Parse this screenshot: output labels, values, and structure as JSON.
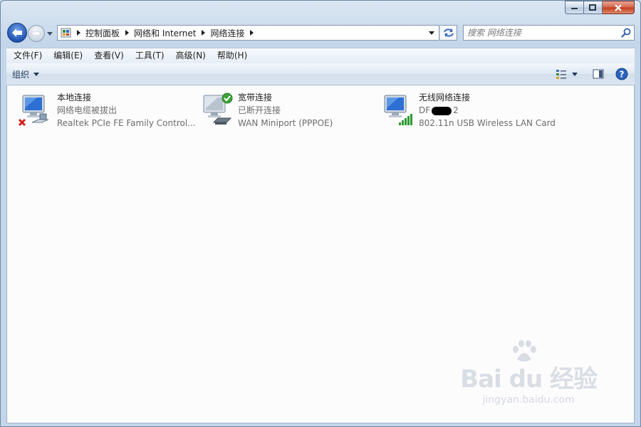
{
  "address": {
    "crumbs": [
      "控制面板",
      "网络和 Internet",
      "网络连接"
    ]
  },
  "search": {
    "placeholder": "搜索 网络连接"
  },
  "menu": [
    "文件(F)",
    "编辑(E)",
    "查看(V)",
    "工具(T)",
    "高级(N)",
    "帮助(H)"
  ],
  "commandbar": {
    "organize_label": "组织"
  },
  "connections": [
    {
      "name": "本地连接",
      "status": "网络电缆被拔出",
      "device": "Realtek PCIe FE Family Control..."
    },
    {
      "name": "宽带连接",
      "status": "已断开连接",
      "device": "WAN Miniport (PPPOE)"
    },
    {
      "name": "无线网络连接",
      "status_prefix": "DF",
      "status_suffix": "2",
      "device": "802.11n USB Wireless LAN Card"
    }
  ],
  "watermark": {
    "main": "Bai  du 经验",
    "sub": "jingyan.baidu.com"
  },
  "colors": {
    "accent": "#2054b4",
    "error": "#d4201a",
    "ok": "#3ea33a",
    "signal": "#2f9a35"
  }
}
